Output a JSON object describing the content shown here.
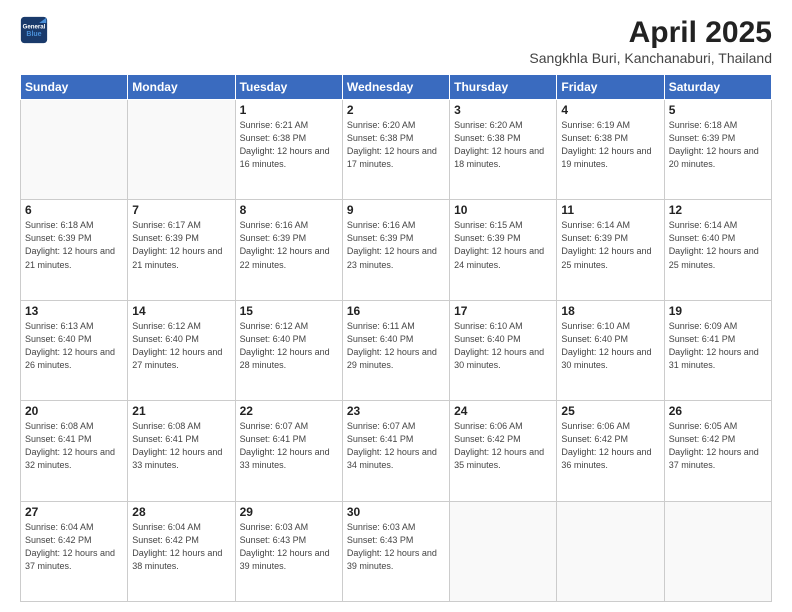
{
  "header": {
    "logo_line1": "General",
    "logo_line2": "Blue",
    "title": "April 2025",
    "subtitle": "Sangkhla Buri, Kanchanaburi, Thailand"
  },
  "days_of_week": [
    "Sunday",
    "Monday",
    "Tuesday",
    "Wednesday",
    "Thursday",
    "Friday",
    "Saturday"
  ],
  "weeks": [
    [
      {
        "num": "",
        "info": ""
      },
      {
        "num": "",
        "info": ""
      },
      {
        "num": "1",
        "info": "Sunrise: 6:21 AM\nSunset: 6:38 PM\nDaylight: 12 hours and 16 minutes."
      },
      {
        "num": "2",
        "info": "Sunrise: 6:20 AM\nSunset: 6:38 PM\nDaylight: 12 hours and 17 minutes."
      },
      {
        "num": "3",
        "info": "Sunrise: 6:20 AM\nSunset: 6:38 PM\nDaylight: 12 hours and 18 minutes."
      },
      {
        "num": "4",
        "info": "Sunrise: 6:19 AM\nSunset: 6:38 PM\nDaylight: 12 hours and 19 minutes."
      },
      {
        "num": "5",
        "info": "Sunrise: 6:18 AM\nSunset: 6:39 PM\nDaylight: 12 hours and 20 minutes."
      }
    ],
    [
      {
        "num": "6",
        "info": "Sunrise: 6:18 AM\nSunset: 6:39 PM\nDaylight: 12 hours and 21 minutes."
      },
      {
        "num": "7",
        "info": "Sunrise: 6:17 AM\nSunset: 6:39 PM\nDaylight: 12 hours and 21 minutes."
      },
      {
        "num": "8",
        "info": "Sunrise: 6:16 AM\nSunset: 6:39 PM\nDaylight: 12 hours and 22 minutes."
      },
      {
        "num": "9",
        "info": "Sunrise: 6:16 AM\nSunset: 6:39 PM\nDaylight: 12 hours and 23 minutes."
      },
      {
        "num": "10",
        "info": "Sunrise: 6:15 AM\nSunset: 6:39 PM\nDaylight: 12 hours and 24 minutes."
      },
      {
        "num": "11",
        "info": "Sunrise: 6:14 AM\nSunset: 6:39 PM\nDaylight: 12 hours and 25 minutes."
      },
      {
        "num": "12",
        "info": "Sunrise: 6:14 AM\nSunset: 6:40 PM\nDaylight: 12 hours and 25 minutes."
      }
    ],
    [
      {
        "num": "13",
        "info": "Sunrise: 6:13 AM\nSunset: 6:40 PM\nDaylight: 12 hours and 26 minutes."
      },
      {
        "num": "14",
        "info": "Sunrise: 6:12 AM\nSunset: 6:40 PM\nDaylight: 12 hours and 27 minutes."
      },
      {
        "num": "15",
        "info": "Sunrise: 6:12 AM\nSunset: 6:40 PM\nDaylight: 12 hours and 28 minutes."
      },
      {
        "num": "16",
        "info": "Sunrise: 6:11 AM\nSunset: 6:40 PM\nDaylight: 12 hours and 29 minutes."
      },
      {
        "num": "17",
        "info": "Sunrise: 6:10 AM\nSunset: 6:40 PM\nDaylight: 12 hours and 30 minutes."
      },
      {
        "num": "18",
        "info": "Sunrise: 6:10 AM\nSunset: 6:40 PM\nDaylight: 12 hours and 30 minutes."
      },
      {
        "num": "19",
        "info": "Sunrise: 6:09 AM\nSunset: 6:41 PM\nDaylight: 12 hours and 31 minutes."
      }
    ],
    [
      {
        "num": "20",
        "info": "Sunrise: 6:08 AM\nSunset: 6:41 PM\nDaylight: 12 hours and 32 minutes."
      },
      {
        "num": "21",
        "info": "Sunrise: 6:08 AM\nSunset: 6:41 PM\nDaylight: 12 hours and 33 minutes."
      },
      {
        "num": "22",
        "info": "Sunrise: 6:07 AM\nSunset: 6:41 PM\nDaylight: 12 hours and 33 minutes."
      },
      {
        "num": "23",
        "info": "Sunrise: 6:07 AM\nSunset: 6:41 PM\nDaylight: 12 hours and 34 minutes."
      },
      {
        "num": "24",
        "info": "Sunrise: 6:06 AM\nSunset: 6:42 PM\nDaylight: 12 hours and 35 minutes."
      },
      {
        "num": "25",
        "info": "Sunrise: 6:06 AM\nSunset: 6:42 PM\nDaylight: 12 hours and 36 minutes."
      },
      {
        "num": "26",
        "info": "Sunrise: 6:05 AM\nSunset: 6:42 PM\nDaylight: 12 hours and 37 minutes."
      }
    ],
    [
      {
        "num": "27",
        "info": "Sunrise: 6:04 AM\nSunset: 6:42 PM\nDaylight: 12 hours and 37 minutes."
      },
      {
        "num": "28",
        "info": "Sunrise: 6:04 AM\nSunset: 6:42 PM\nDaylight: 12 hours and 38 minutes."
      },
      {
        "num": "29",
        "info": "Sunrise: 6:03 AM\nSunset: 6:43 PM\nDaylight: 12 hours and 39 minutes."
      },
      {
        "num": "30",
        "info": "Sunrise: 6:03 AM\nSunset: 6:43 PM\nDaylight: 12 hours and 39 minutes."
      },
      {
        "num": "",
        "info": ""
      },
      {
        "num": "",
        "info": ""
      },
      {
        "num": "",
        "info": ""
      }
    ]
  ]
}
